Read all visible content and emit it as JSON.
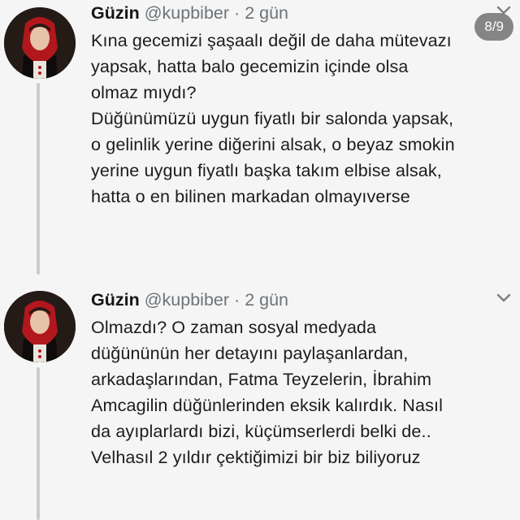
{
  "counter": "8/9",
  "tweets": [
    {
      "name": "Güzin",
      "handle": "@kupbiber",
      "separator": "·",
      "time": "2 gün",
      "lines": [
        "Kına gecemizi şaşaalı değil de daha mütevazı",
        "yapsak, hatta balo gecemizin içinde olsa",
        "olmaz mıydı?",
        "Düğünümüzü uygun fiyatlı bir salonda yapsak,",
        "o gelinlik yerine diğerini alsak, o beyaz smokin",
        "yerine  uygun fiyatlı başka takım elbise alsak,",
        "hatta o en bilinen markadan olmayıverse"
      ]
    },
    {
      "name": "Güzin",
      "handle": "@kupbiber",
      "separator": "·",
      "time": "2 gün",
      "lines": [
        "Olmazdı? O zaman sosyal medyada",
        "düğününün her detayını paylaşanlardan,",
        "arkadaşlarından, Fatma Teyzelerin, İbrahim",
        "Amcagilin düğünlerinden eksik kalırdık. Nasıl",
        "da ayıplarlardı bizi, küçümserlerdi belki de..",
        "Velhasıl 2 yıldır çektiğimizi bir biz biliyoruz"
      ]
    }
  ],
  "icons": {
    "avatar": "avatar-photo",
    "more": "chevron-down-icon"
  },
  "colors": {
    "background": "#f4f5f4",
    "text": "#1c1c1c",
    "muted": "#6d7378",
    "thread_line": "#c8cdd2"
  }
}
